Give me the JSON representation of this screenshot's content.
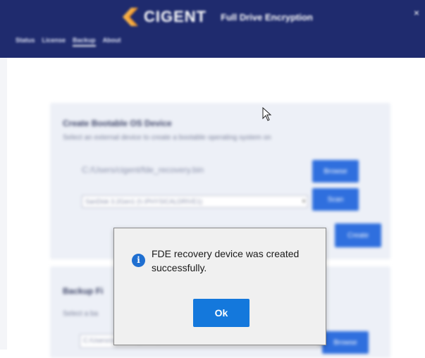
{
  "app": {
    "brand": "CIGENT",
    "product": "Full Drive Encryption",
    "close_glyph": "×",
    "accent_color": "#1f2b6e"
  },
  "tabs": [
    "Status",
    "License",
    "Backup",
    "About"
  ],
  "active_tab": "Backup",
  "create_section": {
    "title": "Create Bootable OS Device",
    "subtitle": "Select an external device to create a bootable operating system on",
    "path_value": "C:/Users/cigent/fde_recovery.bin",
    "browse_label": "Browse",
    "device_selected": "SanDisk 3.2Gen1 (\\\\.\\PHYSICALDRIVE1)",
    "scan_label": "Scan",
    "create_label": "Create"
  },
  "backup_section": {
    "title": "Backup Fi",
    "subtitle": "Select a ba",
    "path_value": "C:/Users/cigent/fde_backup.bin",
    "button_label": "Browse"
  },
  "dialog": {
    "icon": "info-icon",
    "message": "FDE recovery device was created successfully.",
    "ok_label": "Ok"
  }
}
